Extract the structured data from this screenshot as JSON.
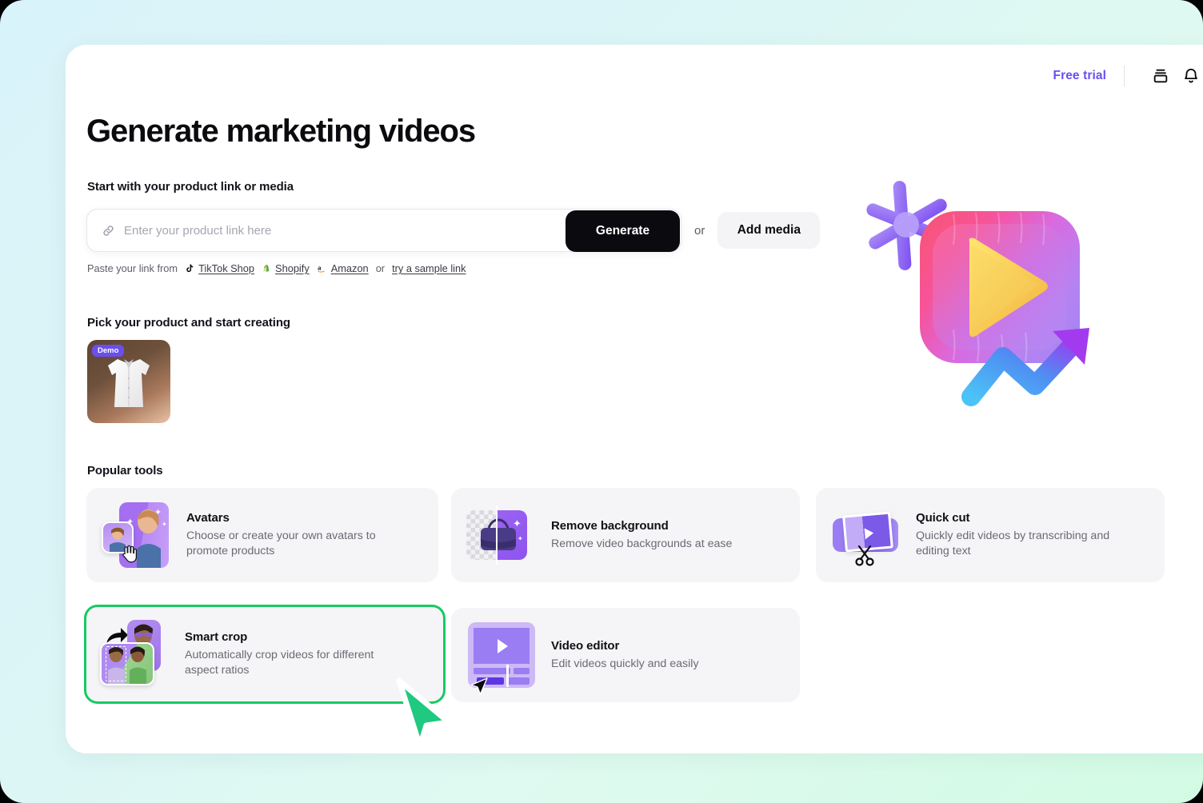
{
  "topbar": {
    "free_trial_label": "Free trial",
    "icons": [
      {
        "name": "archive-drawer-icon"
      },
      {
        "name": "bell-notification-icon"
      }
    ]
  },
  "page": {
    "title": "Generate marketing videos",
    "start_label": "Start with your product link or media",
    "pick_label": "Pick your product and start creating",
    "tools_label": "Popular tools"
  },
  "input": {
    "placeholder": "Enter your product link here",
    "value": "",
    "generate_label": "Generate",
    "or_label": "or",
    "add_media_label": "Add media"
  },
  "paste": {
    "prefix": "Paste your link from",
    "brands": [
      {
        "label": "TikTok Shop",
        "icon": "tiktok-icon"
      },
      {
        "label": "Shopify",
        "icon": "shopify-icon"
      },
      {
        "label": "Amazon",
        "icon": "amazon-icon"
      }
    ],
    "or_label": "or",
    "sample_label": "try a sample link"
  },
  "product": {
    "badge": "Demo",
    "alt": "white dress shirt product image"
  },
  "tools": [
    {
      "id": "avatars",
      "title": "Avatars",
      "desc": "Choose or create your own avatars to promote products",
      "selected": false
    },
    {
      "id": "remove-background",
      "title": "Remove background",
      "desc": "Remove video backgrounds at ease",
      "selected": false
    },
    {
      "id": "quick-cut",
      "title": "Quick cut",
      "desc": "Quickly edit videos by transcribing and editing text",
      "selected": false
    },
    {
      "id": "smart-crop",
      "title": "Smart crop",
      "desc": "Automatically crop videos for different aspect ratios",
      "selected": true
    },
    {
      "id": "video-editor",
      "title": "Video editor",
      "desc": "Edit videos quickly and easily",
      "selected": false
    }
  ],
  "colors": {
    "accent_purple": "#6B4EF0",
    "selected_green": "#17C964",
    "cursor_green": "#20C87C",
    "card_bg": "#F5F5F7",
    "page_bg_start": "#D9F3FA",
    "page_bg_end": "#D2FBE4",
    "button_dark": "#0B0B0F"
  },
  "hero_illustration": {
    "name": "3d-play-button-growth-illustration",
    "parts": [
      "sparkle-star",
      "inflated-play-square",
      "growth-arrow"
    ]
  }
}
